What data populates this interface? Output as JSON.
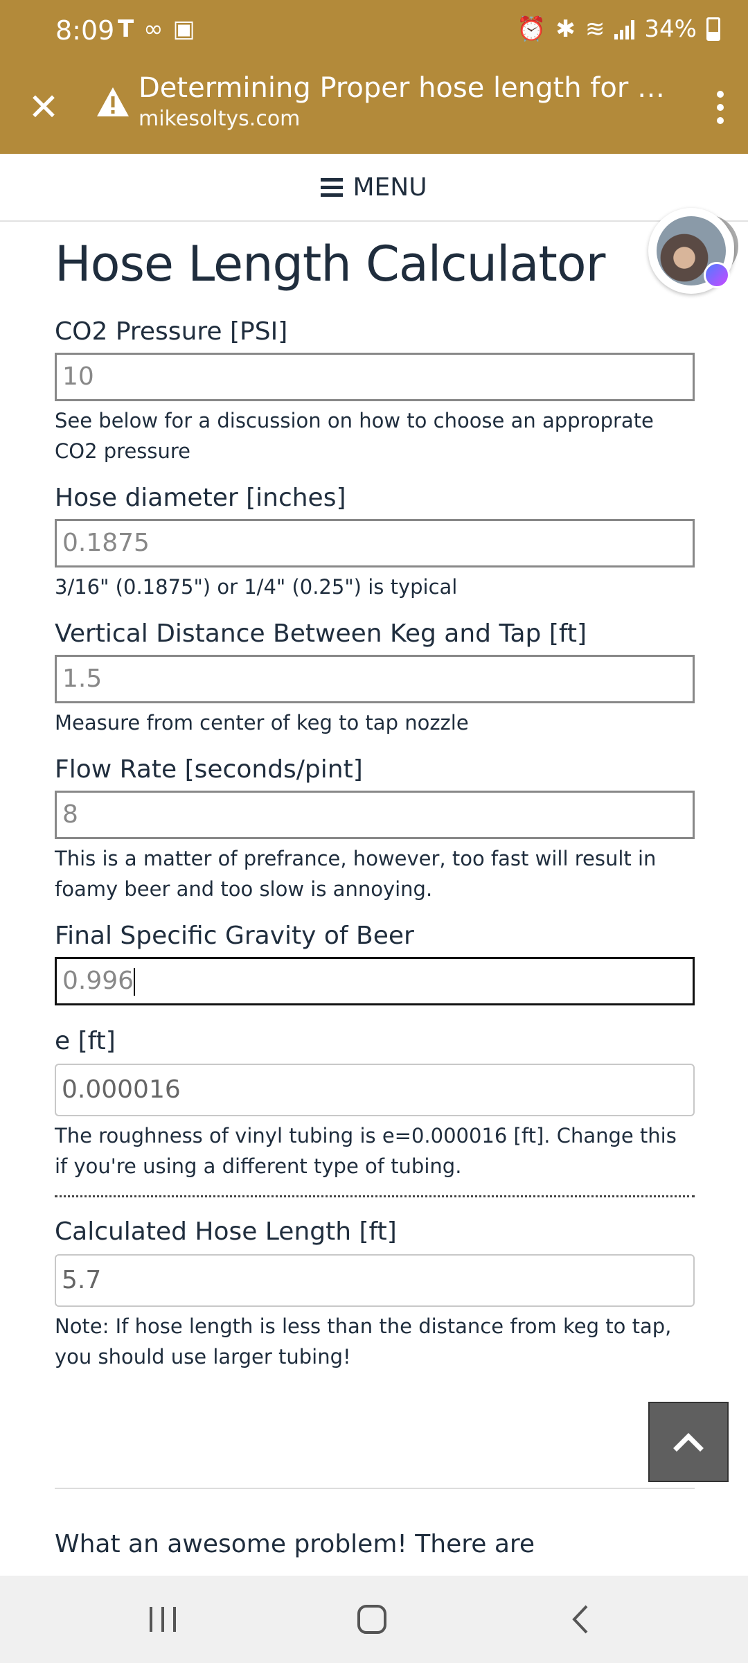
{
  "status_bar": {
    "time": "8:09",
    "battery": "34%"
  },
  "browser": {
    "tab_title": "Determining Proper hose length for yo...",
    "domain": "mikesoltys.com"
  },
  "menu": {
    "label": "MENU"
  },
  "page": {
    "title": "Hose Length Calculator",
    "fields": [
      {
        "label": "CO2 Pressure [PSI]",
        "value": "10",
        "hint": "See below for a discussion on how to choose an approprate CO2 pressure"
      },
      {
        "label": "Hose diameter [inches]",
        "value": "0.1875",
        "hint": "3/16\" (0.1875\") or 1/4\" (0.25\") is typical"
      },
      {
        "label": "Vertical Distance Between Keg and Tap [ft]",
        "value": "1.5",
        "hint": "Measure from center of keg to tap nozzle"
      },
      {
        "label": "Flow Rate [seconds/pint]",
        "value": "8",
        "hint": "This is a matter of prefrance, however, too fast will result in foamy beer and too slow is annoying."
      },
      {
        "label": "Final Specific Gravity of Beer",
        "value": "0.996",
        "hint": ""
      },
      {
        "label": "e [ft]",
        "value": "0.000016",
        "hint": "The roughness of vinyl tubing is e=0.000016 [ft]. Change this if you're using a different type of tubing."
      }
    ],
    "result": {
      "label": "Calculated Hose Length [ft]",
      "value": "5.7",
      "hint": "Note: If hose length is less than the distance from keg to tap, you should use larger tubing!"
    },
    "paragraph_start": "What an awesome problem! There are"
  },
  "colors": {
    "chrome": "#b38a3a",
    "text": "#1f2d3d",
    "navbar": "#f0f0f0"
  }
}
